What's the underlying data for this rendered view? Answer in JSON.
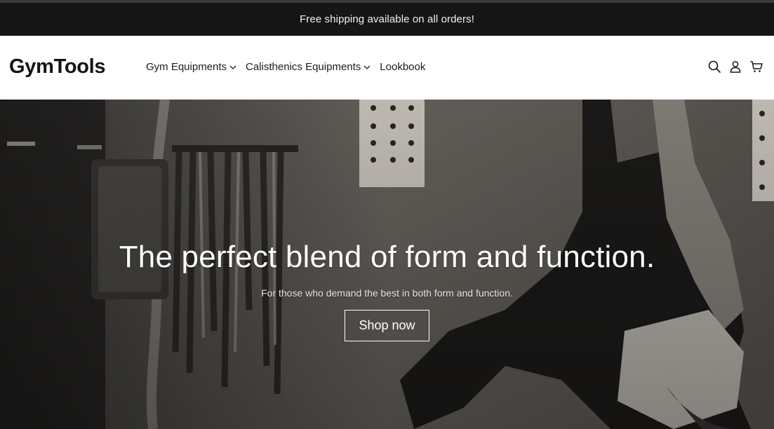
{
  "announcement": {
    "text": "Free shipping available on all orders!"
  },
  "header": {
    "logo": "GymTools",
    "nav": [
      {
        "label": "Gym Equipments",
        "has_dropdown": true
      },
      {
        "label": "Calisthenics Equipments",
        "has_dropdown": true
      },
      {
        "label": "Lookbook",
        "has_dropdown": false
      }
    ],
    "icons": [
      "search-icon",
      "account-icon",
      "cart-icon"
    ]
  },
  "hero": {
    "title": "The perfect blend of form and function.",
    "subtitle": "For those who demand the best in both form and function.",
    "cta": "Shop now"
  },
  "colors": {
    "announcement_bg": "#161616",
    "header_bg": "#ffffff",
    "text_dark": "#141414",
    "hero_text": "#ffffff"
  }
}
